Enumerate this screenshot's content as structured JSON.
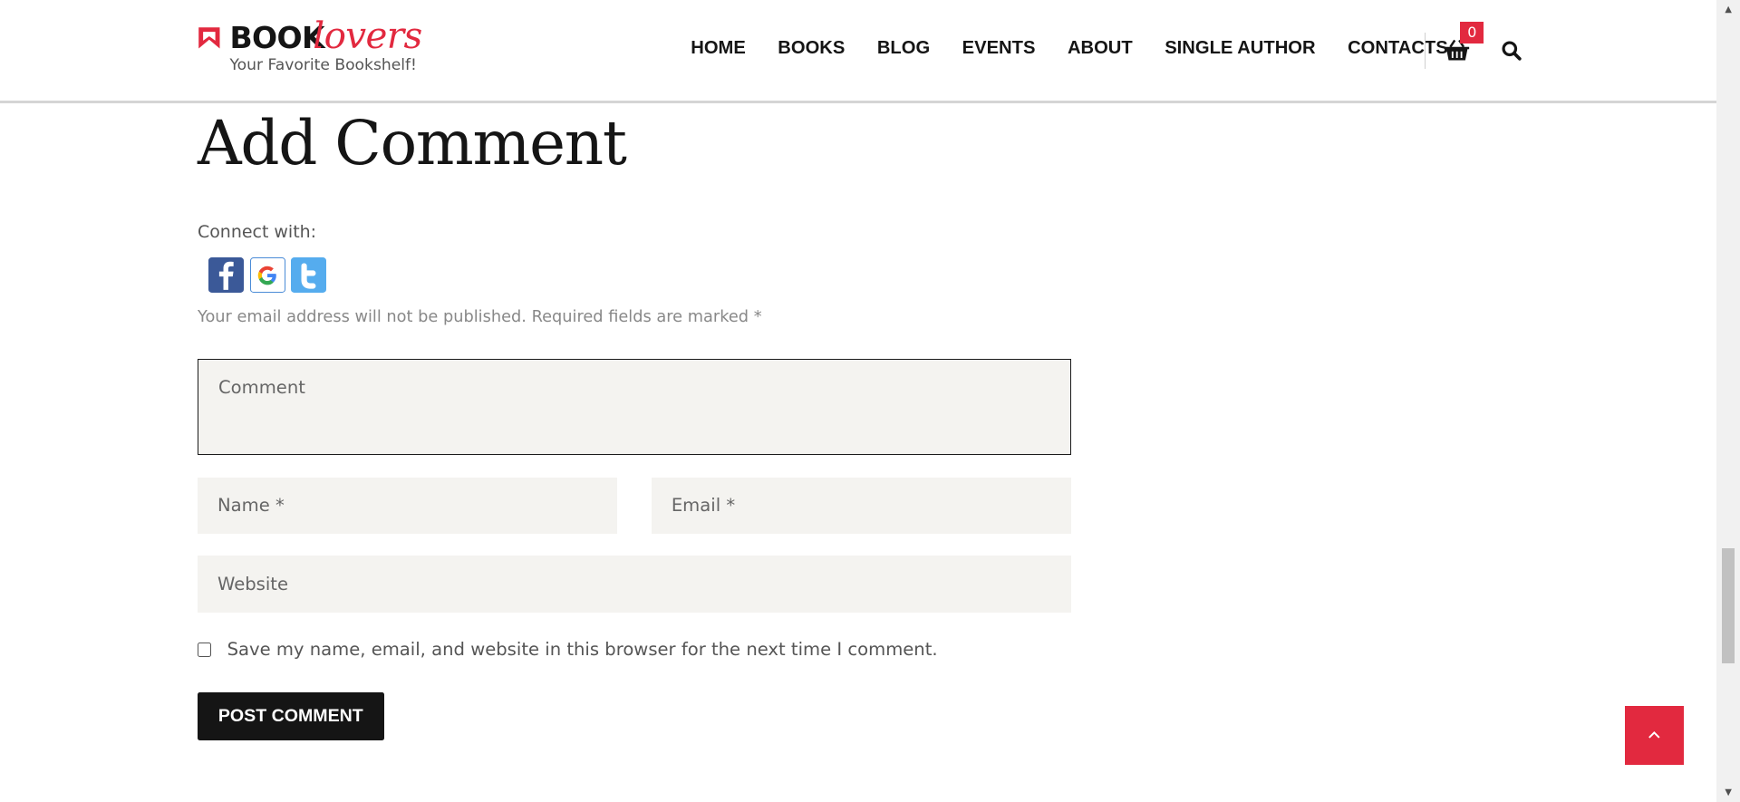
{
  "colors": {
    "accent": "#e2293f",
    "text": "#151515",
    "field_bg": "#f4f3f0",
    "button_bg": "#151515"
  },
  "logo": {
    "part1": "BOOK",
    "part2": "lovers",
    "tagline": "Your Favorite Bookshelf!"
  },
  "nav": [
    "HOME",
    "BOOKS",
    "BLOG",
    "EVENTS",
    "ABOUT",
    "SINGLE AUTHOR",
    "CONTACTS"
  ],
  "cart": {
    "count": "0",
    "icon": "basket-icon"
  },
  "search": {
    "icon": "search-icon"
  },
  "page": {
    "title": "Add Comment"
  },
  "connect": {
    "label": "Connect with:",
    "providers": [
      "facebook",
      "google",
      "twitter"
    ]
  },
  "notice": "Your email address will not be published. Required fields are marked *",
  "form": {
    "comment_placeholder": "Comment",
    "name_placeholder": "Name *",
    "email_placeholder": "Email *",
    "website_placeholder": "Website",
    "save_label": "Save my name, email, and website in this browser for the next time I comment.",
    "submit": "POST COMMENT"
  },
  "scroll_to_top": {
    "icon": "chevron-up-icon"
  }
}
